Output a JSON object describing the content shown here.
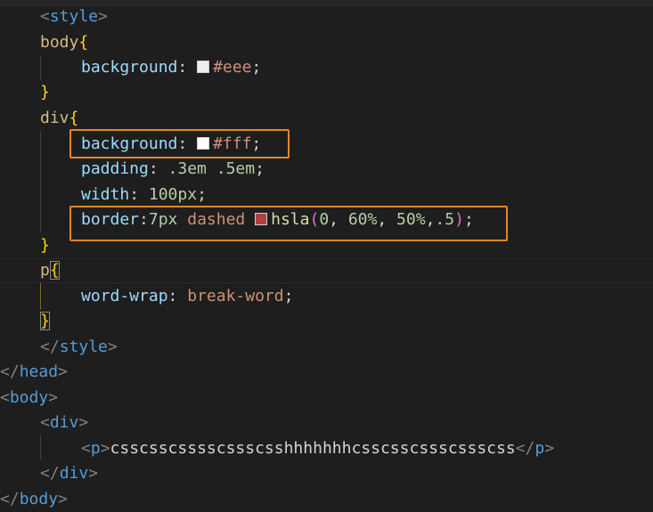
{
  "editor": {
    "lines": {
      "style_open": "style",
      "body_selector": "body",
      "body_background_prop": "background",
      "body_background_value": "#eee",
      "div_selector": "div",
      "div_background_prop": "background",
      "div_background_value": "#fff",
      "div_padding_prop": "padding",
      "div_padding_value1": ".3em",
      "div_padding_value2": ".5em",
      "div_width_prop": "width",
      "div_width_value": "100px",
      "div_border_prop": "border",
      "div_border_width": "7px",
      "div_border_style": "dashed",
      "div_border_fn": "hsla",
      "div_border_arg1": "0",
      "div_border_arg2": "60%",
      "div_border_arg3": "50%",
      "div_border_arg4": ".5",
      "p_selector": "p",
      "p_wrap_prop": "word-wrap",
      "p_wrap_value": "break-word",
      "style_close": "style",
      "head_close": "head",
      "body_open": "body",
      "div_open": "div",
      "p_tag": "p",
      "p_text": "csscsscsssscssscsshhhhhhhcsscsscssscssscss",
      "p_close": "p",
      "div_close": "div",
      "body_close": "body"
    },
    "swatch_colors": {
      "eee": "#eeeeee",
      "fff": "#ffffff",
      "hsla": "#b34040"
    },
    "highlight_color": "#e8842b"
  }
}
